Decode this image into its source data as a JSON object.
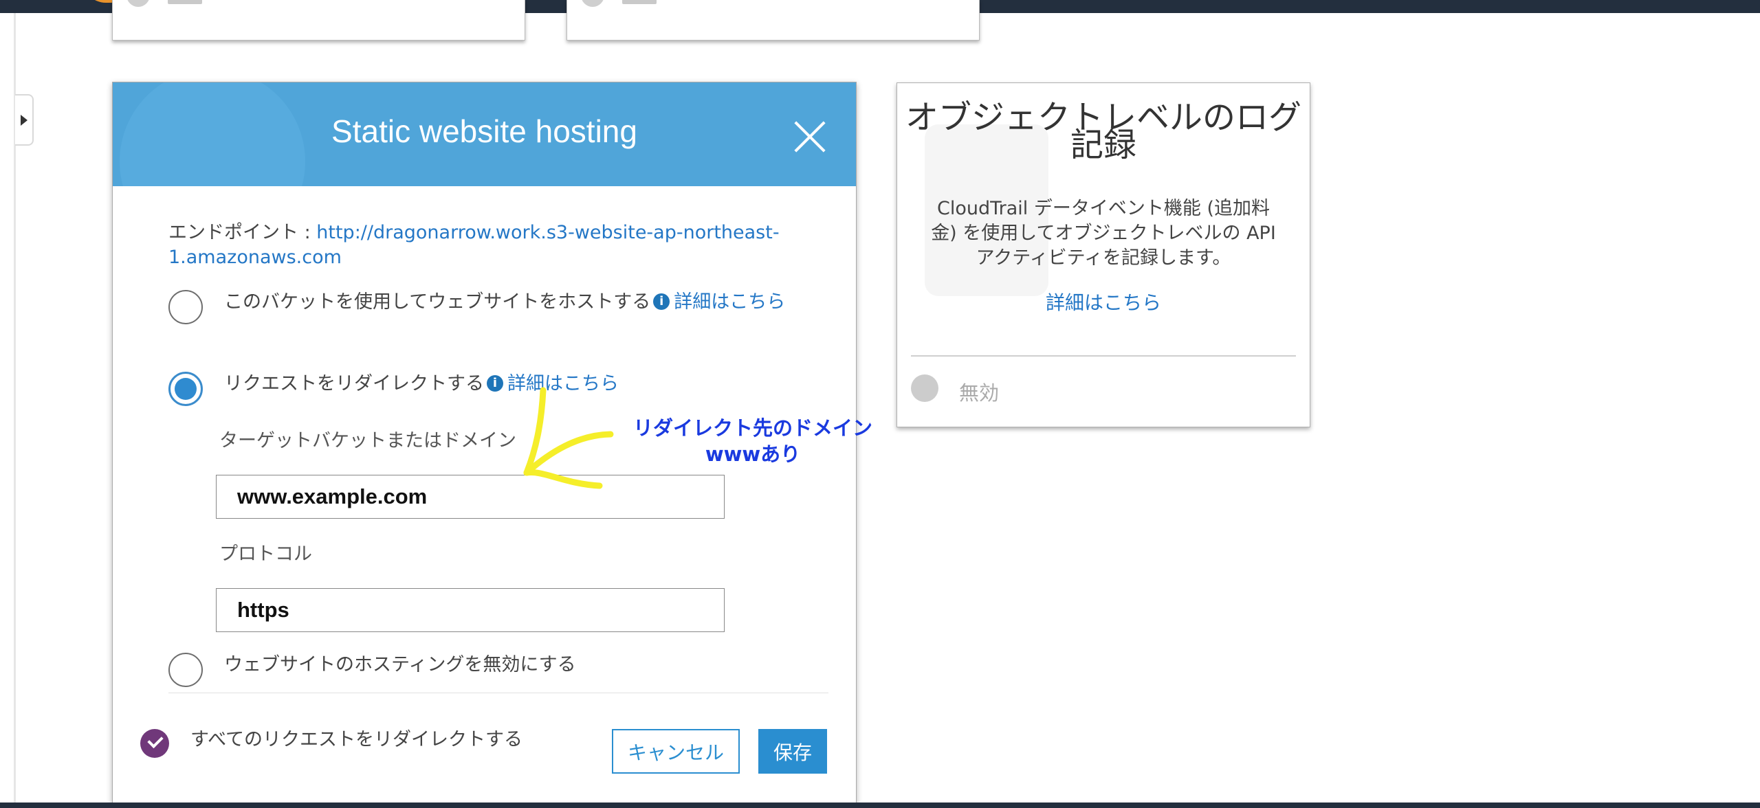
{
  "modal": {
    "title": "Static website hosting",
    "endpoint_label": "エンドポイント : ",
    "endpoint_url": "http://dragonarrow.work.s3-website-ap-northeast-1.amazonaws.com",
    "options": [
      {
        "label": "このバケットを使用してウェブサイトをホストする",
        "more": "詳細はこちら",
        "selected": false
      },
      {
        "label": "リクエストをリダイレクトする",
        "more": "詳細はこちら",
        "selected": true
      },
      {
        "label": "ウェブサイトのホスティングを無効にする",
        "selected": false
      }
    ],
    "target_label": "ターゲットバケットまたはドメイン",
    "target_value": "www.example.com",
    "protocol_label": "プロトコル",
    "protocol_value": "https",
    "checkbox_label": "すべてのリクエストをリダイレクトする",
    "cancel_label": "キャンセル",
    "save_label": "保存"
  },
  "log_card": {
    "title": "オブジェクトレベルのログ記録",
    "description": "CloudTrail データイベント機能 (追加料金) を使用してオブジェクトレベルの API アクティビティを記録します。",
    "more": "詳細はこちら",
    "status": "無効"
  },
  "annotation": {
    "line1": "リダイレクト先のドメイン",
    "line2": "wwwあり"
  },
  "colors": {
    "header": "#50a5d9",
    "link": "#2477c6",
    "button": "#2a8ed0",
    "checkbox": "#70387a",
    "annotation_arrow": "#f5ee2a",
    "annotation_text": "#1a3adf",
    "topbar": "#232f3e"
  },
  "icons": [
    "chevron-right-icon",
    "close-icon",
    "info-icon",
    "check-icon",
    "globe-icon",
    "annotation-arrow-icon"
  ]
}
